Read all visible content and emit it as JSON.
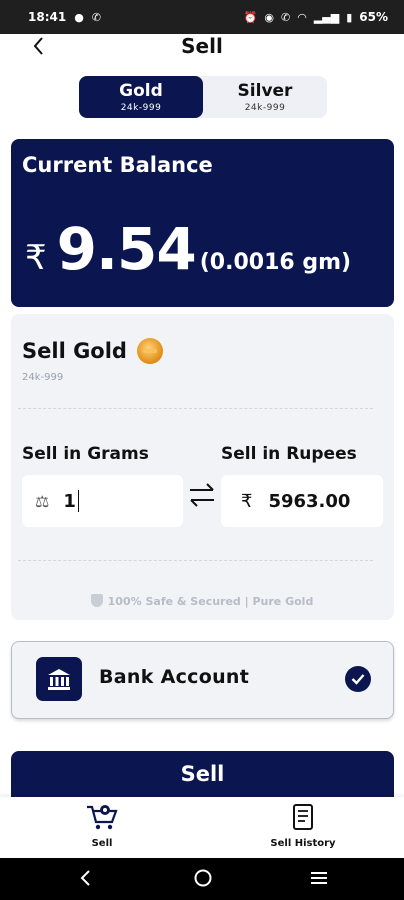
{
  "status_bar": {
    "time": "18:41",
    "battery": "65%"
  },
  "header": {
    "title": "Sell"
  },
  "metal_toggle": {
    "tabs": [
      {
        "name": "Gold",
        "purity": "24k-999",
        "active": true
      },
      {
        "name": "Silver",
        "purity": "24k-999",
        "active": false
      }
    ]
  },
  "balance": {
    "title": "Current Balance",
    "currency_symbol": "₹",
    "amount": "9.54",
    "grams": "(0.0016 gm)"
  },
  "sell_section": {
    "title": "Sell Gold",
    "purity": "24k-999",
    "grams_label": "Sell in Grams",
    "rupees_label": "Sell in Rupees",
    "grams_value": "1",
    "rupee_symbol": "₹",
    "rupees_value": "5963.00",
    "safe_text": "100% Safe & Secured | Pure Gold"
  },
  "bank": {
    "label": "Bank Account",
    "selected": true
  },
  "sell_button": {
    "label": "Sell"
  },
  "bottom_nav": {
    "items": [
      {
        "label": "Sell",
        "icon": "cart-icon",
        "active": true
      },
      {
        "label": "Sell History",
        "icon": "history-icon",
        "active": false
      }
    ]
  },
  "colors": {
    "primary": "#0b1650",
    "card_bg": "#f1f3f7",
    "gold": "#e08a12"
  }
}
